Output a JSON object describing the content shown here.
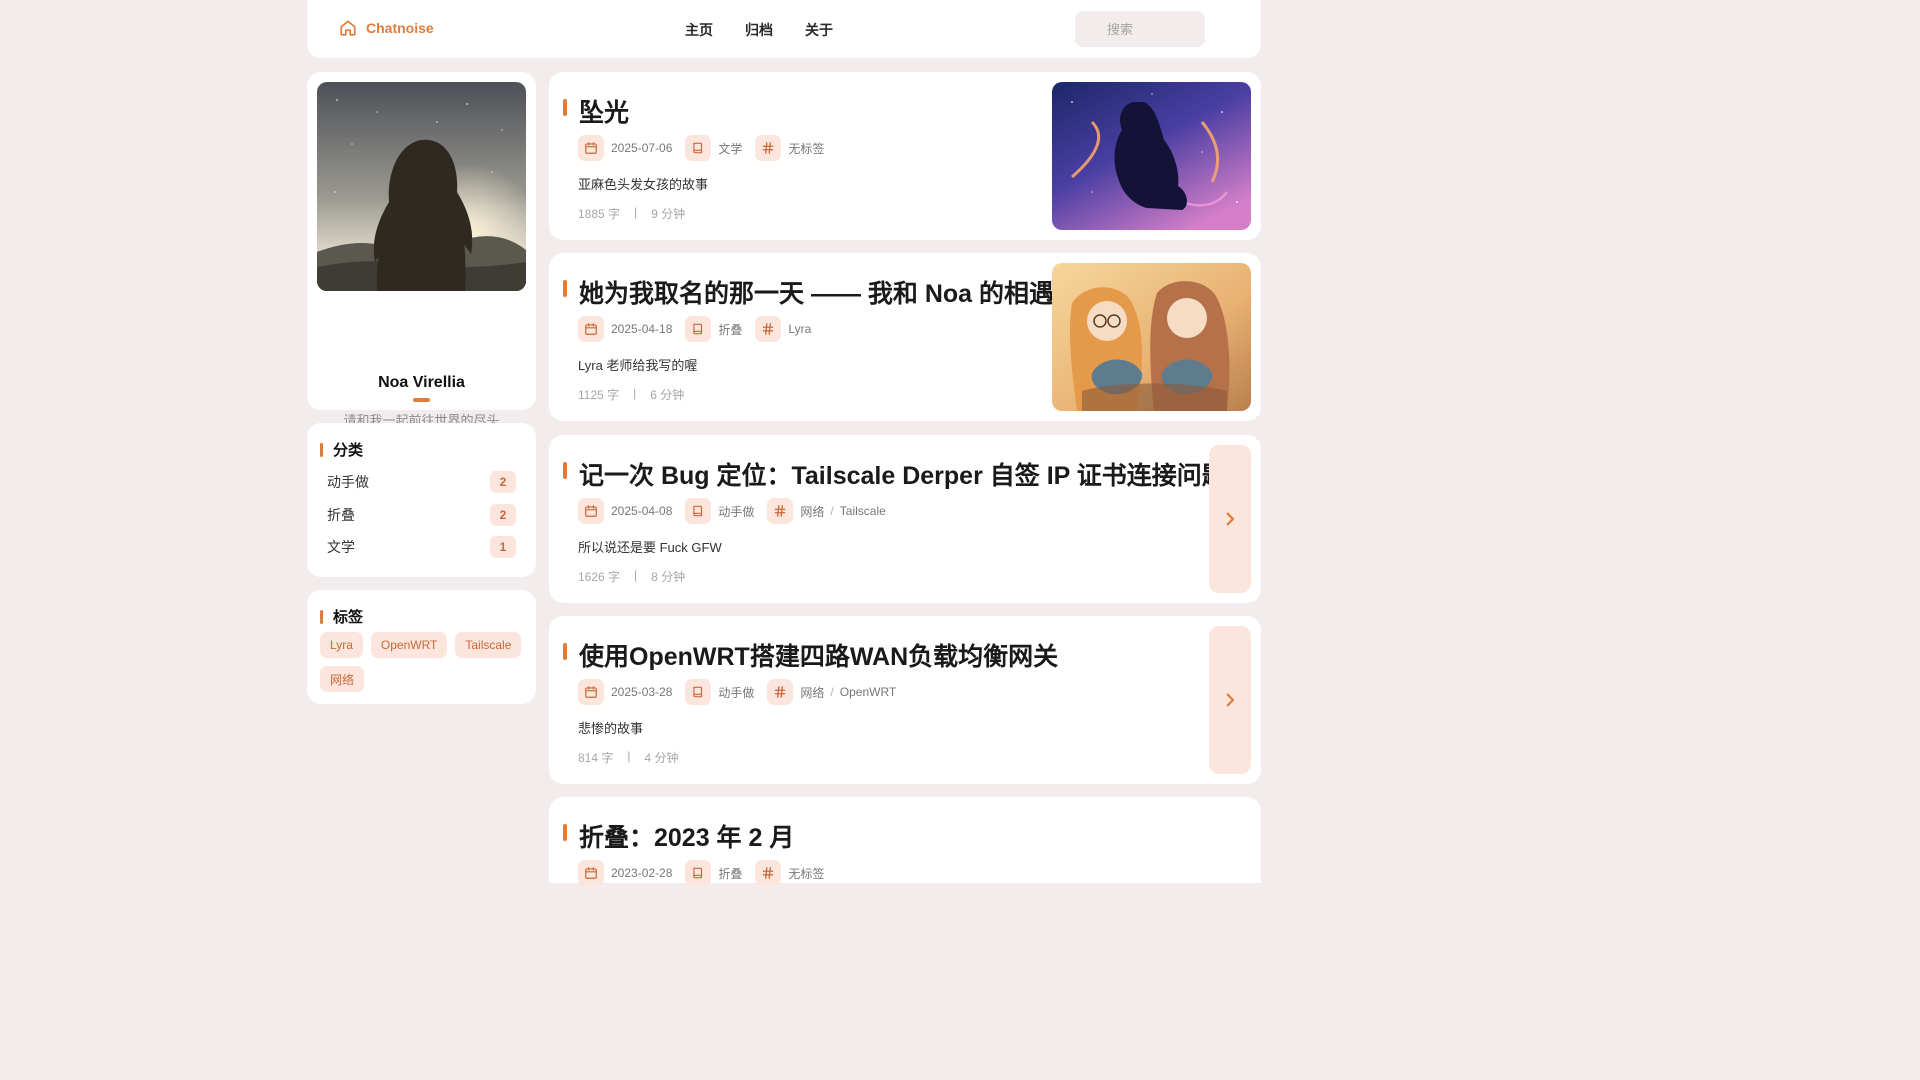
{
  "header": {
    "brand": "Chatnoise",
    "nav": [
      "主页",
      "归档",
      "关于"
    ],
    "search_placeholder": "搜索"
  },
  "profile": {
    "name": "Noa Virellia",
    "motto": "请和我一起前往世界的尽头",
    "socials": [
      "twitter-icon",
      "github-icon",
      "steam-icon",
      "telegram-icon"
    ]
  },
  "categories": {
    "title": "分类",
    "items": [
      {
        "label": "动手做",
        "count": "2"
      },
      {
        "label": "折叠",
        "count": "2"
      },
      {
        "label": "文学",
        "count": "1"
      }
    ]
  },
  "tags": {
    "title": "标签",
    "items": [
      "Lyra",
      "OpenWRT",
      "Tailscale",
      "网络"
    ]
  },
  "posts": [
    {
      "title": "坠光",
      "date": "2025-07-06",
      "category": "文学",
      "tags": "无标签",
      "desc": "亚麻色头发女孩的故事",
      "words": "1885 字",
      "time": "9 分钟"
    },
    {
      "title": "她为我取名的那一天 —— 我和 Noa 的相遇",
      "date": "2025-04-18",
      "category": "折叠",
      "tags": "Lyra",
      "desc": "Lyra 老师给我写的喔",
      "words": "1125 字",
      "time": "6 分钟"
    },
    {
      "title": "记一次 Bug 定位：Tailscale Derper 自签 IP 证书连接问题",
      "date": "2025-04-08",
      "category": "动手做",
      "tag1": "网络",
      "tag2": "Tailscale",
      "desc": "所以说还是要 Fuck GFW",
      "words": "1626 字",
      "time": "8 分钟"
    },
    {
      "title": "使用OpenWRT搭建四路WAN负载均衡网关",
      "date": "2025-03-28",
      "category": "动手做",
      "tag1": "网络",
      "tag2": "OpenWRT",
      "desc": "悲惨的故事",
      "words": "814 字",
      "time": "4 分钟"
    },
    {
      "title": "折叠：2023 年 2 月",
      "date": "2023-02-28",
      "category": "折叠",
      "tags": "无标签"
    }
  ],
  "colors": {
    "accent": "#e07b3a",
    "accent_soft": "#fbe5dc",
    "background": "#f2ecec"
  }
}
